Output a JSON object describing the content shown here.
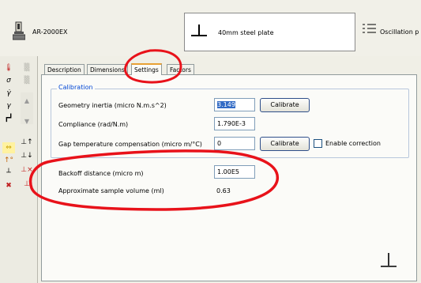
{
  "header": {
    "instrument_name": "AR-2000EX",
    "geometry_name": "40mm steel plate",
    "procedure_name": "Oscillation p"
  },
  "tabs": [
    {
      "label": "Description"
    },
    {
      "label": "Dimensions"
    },
    {
      "label": "Settings"
    },
    {
      "label": "Factors"
    }
  ],
  "active_tab": "Settings",
  "calibration": {
    "title": "Calibration",
    "geometry_inertia": {
      "label": "Geometry inertia (micro N.m.s^2)",
      "value": "3.149",
      "button": "Calibrate"
    },
    "compliance": {
      "label": "Compliance (rad/N.m)",
      "value": "1.790E-3"
    },
    "gap_temp": {
      "label": "Gap temperature compensation (micro m/°C)",
      "value": "0",
      "button": "Calibrate",
      "checkbox_label": "Enable correction",
      "checked": false
    }
  },
  "backoff": {
    "label": "Backoff distance (micro m)",
    "value": "1.00E5"
  },
  "sample_volume": {
    "label": "Approximate sample volume (ml)",
    "value": "0.63"
  },
  "left_toolbar": {
    "icons": [
      "temperature-icon",
      "stress-icon",
      "strain-rate-icon",
      "strain-icon",
      "geometry-icon",
      "oscillation-icon",
      "torque-icon",
      "normal-force-icon",
      "gap-icon",
      "zero-gap-icon",
      "clear-icon"
    ]
  },
  "colors": {
    "annotation": "#e8121a",
    "group_title": "#0046d5",
    "tab_highlight": "#e8a034"
  }
}
